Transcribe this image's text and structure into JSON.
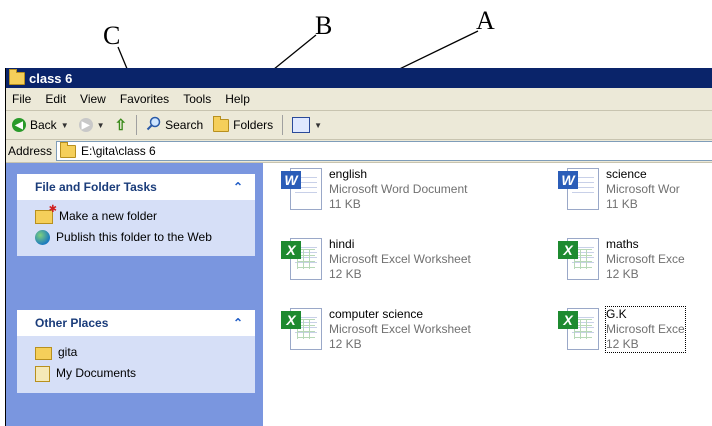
{
  "annotations": {
    "a": "A",
    "b": "B",
    "c": "C"
  },
  "window": {
    "title": "class 6",
    "titlebar_color": "#0a246a"
  },
  "menu": [
    "File",
    "Edit",
    "View",
    "Favorites",
    "Tools",
    "Help"
  ],
  "toolbar": {
    "back": "Back",
    "search": "Search",
    "folders": "Folders"
  },
  "address": {
    "label": "Address",
    "path": "E:\\gita\\class 6"
  },
  "tasks": {
    "file_folder": {
      "title": "File and Folder Tasks",
      "collapse": "⌃",
      "items": [
        "Make a new folder",
        "Publish this folder to the Web"
      ]
    },
    "other_places": {
      "title": "Other Places",
      "collapse": "⌃",
      "items": [
        "gita",
        "My Documents"
      ]
    }
  },
  "files": [
    {
      "name": "english",
      "type": "Microsoft Word Document",
      "size": "11 KB",
      "icon": "word-doc-icon"
    },
    {
      "name": "science",
      "type": "Microsoft Wor",
      "size": "11 KB",
      "icon": "word-doc-icon"
    },
    {
      "name": "hindi",
      "type": "Microsoft Excel Worksheet",
      "size": "12 KB",
      "icon": "excel-sheet-icon"
    },
    {
      "name": "maths",
      "type": "Microsoft Exce",
      "size": "12 KB",
      "icon": "excel-sheet-icon"
    },
    {
      "name": "computer science",
      "type": "Microsoft Excel Worksheet",
      "size": "12 KB",
      "icon": "excel-sheet-icon"
    },
    {
      "name": "G.K",
      "type": "Microsoft Exce",
      "size": "12 KB",
      "icon": "excel-sheet-icon"
    }
  ]
}
